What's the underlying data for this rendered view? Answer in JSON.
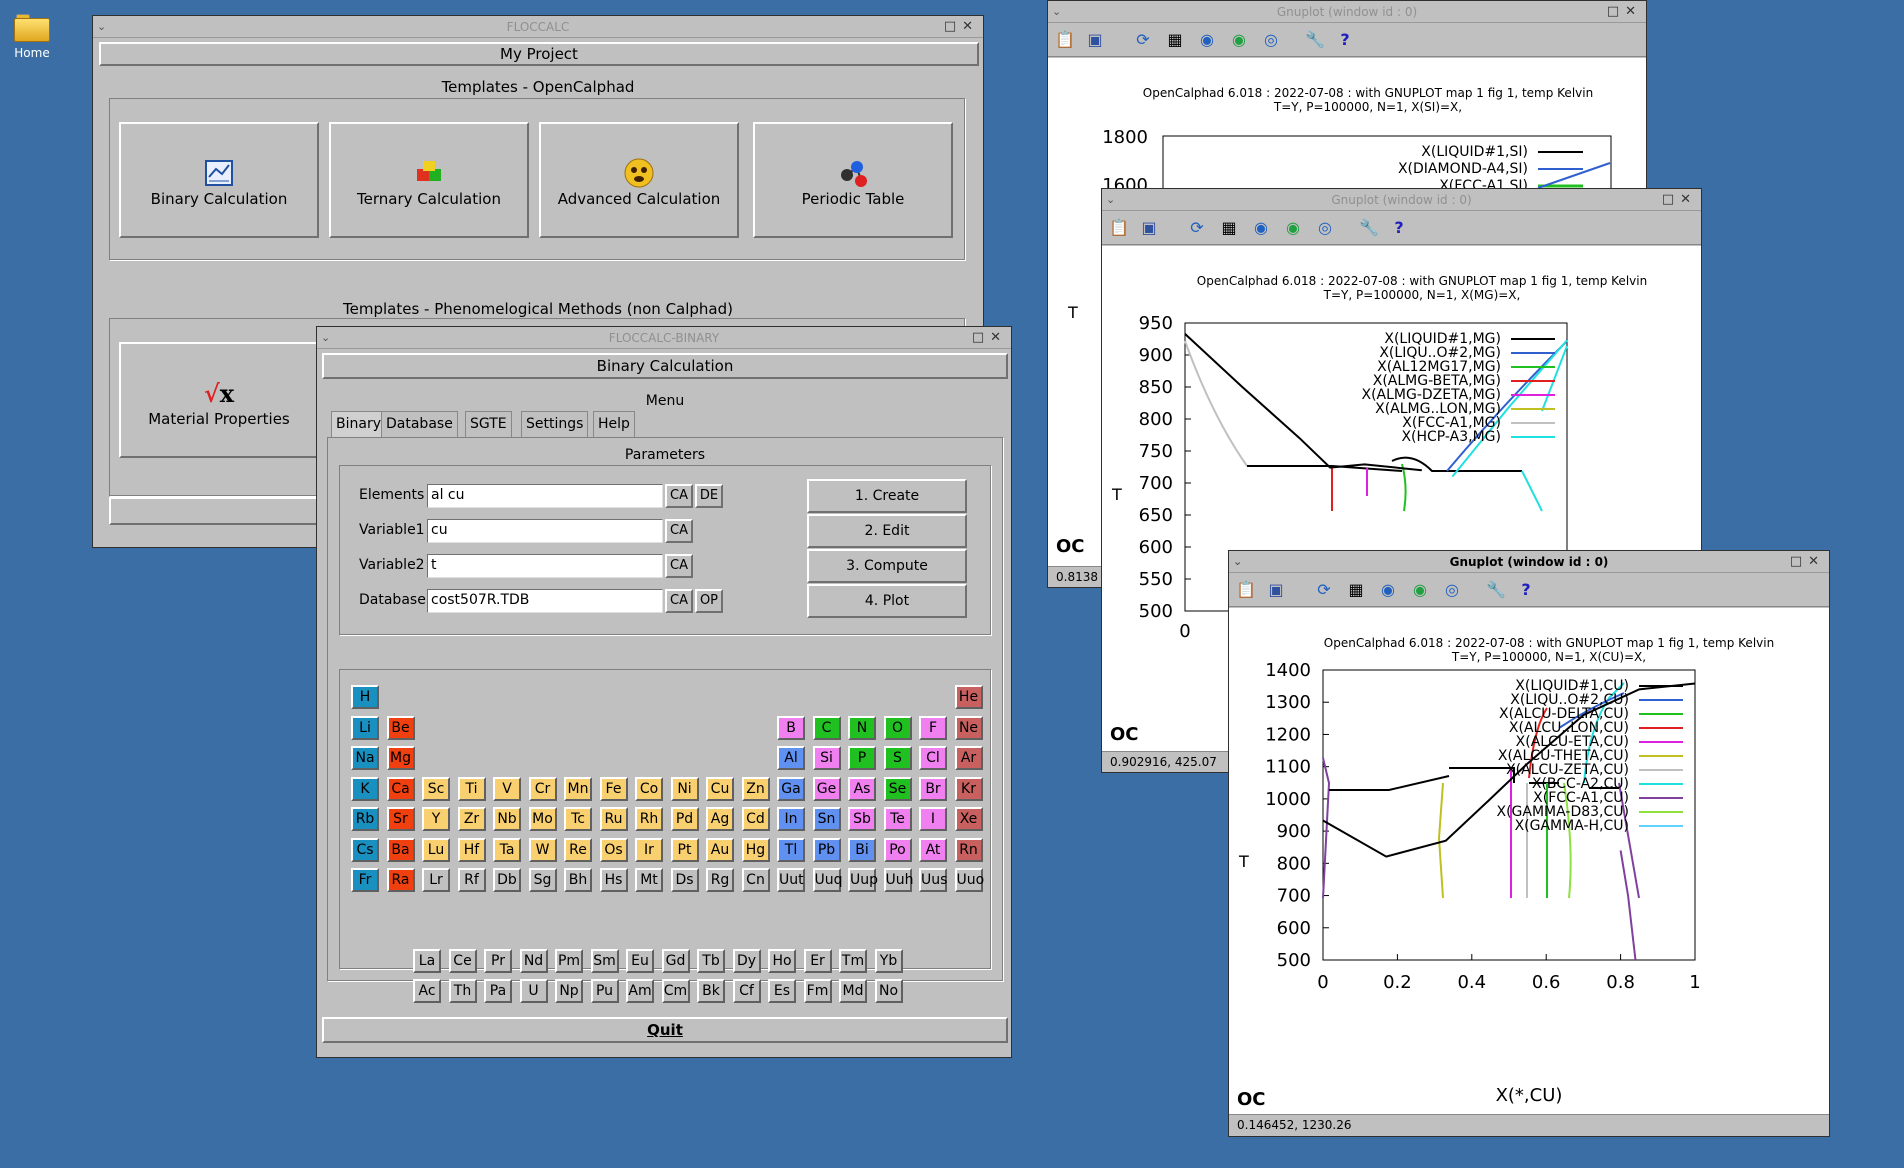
{
  "desktop": {
    "home_label": "Home"
  },
  "floccalc": {
    "title": "FLOCCALC",
    "project_button": "My Project",
    "templates_opencalphad": "Templates - OpenCalphad",
    "btn_binary": "Binary Calculation",
    "btn_ternary": "Ternary Calculation",
    "btn_advanced": "Advanced Calculation",
    "btn_periodic": "Periodic Table",
    "templates_pheno": "Templates - Phenomelogical Methods (non Calphad)",
    "btn_material": "Material Properties"
  },
  "binary": {
    "title": "FLOCCALC-BINARY",
    "header": "Binary Calculation",
    "menu_label": "Menu",
    "tabs": [
      "Binary",
      "Database",
      "SGTE",
      "Settings",
      "Help"
    ],
    "params_label": "Parameters",
    "fields": {
      "elements_label": "Elements",
      "elements_value": "al cu",
      "var1_label": "Variable1",
      "var1_value": "cu",
      "var2_label": "Variable2",
      "var2_value": "t",
      "db_label": "Database",
      "db_value": "cost507R.TDB"
    },
    "small_btns": {
      "ca": "CA",
      "de": "DE",
      "op": "OP"
    },
    "actions": [
      "1. Create",
      "2. Edit",
      "3. Compute",
      "4. Plot"
    ],
    "quit": "Quit",
    "periodic_rows": [
      [
        "H",
        "",
        "",
        "",
        "",
        "",
        "",
        "",
        "",
        "",
        "",
        "",
        "",
        "",
        "",
        "",
        "",
        "He"
      ],
      [
        "Li",
        "Be",
        "",
        "",
        "",
        "",
        "",
        "",
        "",
        "",
        "",
        "",
        "B",
        "C",
        "N",
        "O",
        "F",
        "Ne"
      ],
      [
        "Na",
        "Mg",
        "",
        "",
        "",
        "",
        "",
        "",
        "",
        "",
        "",
        "",
        "Al",
        "Si",
        "P",
        "S",
        "Cl",
        "Ar"
      ],
      [
        "K",
        "Ca",
        "Sc",
        "Ti",
        "V",
        "Cr",
        "Mn",
        "Fe",
        "Co",
        "Ni",
        "Cu",
        "Zn",
        "Ga",
        "Ge",
        "As",
        "Se",
        "Br",
        "Kr"
      ],
      [
        "Rb",
        "Sr",
        "Y",
        "Zr",
        "Nb",
        "Mo",
        "Tc",
        "Ru",
        "Rh",
        "Pd",
        "Ag",
        "Cd",
        "In",
        "Sn",
        "Sb",
        "Te",
        "I",
        "Xe"
      ],
      [
        "Cs",
        "Ba",
        "Lu",
        "Hf",
        "Ta",
        "W",
        "Re",
        "Os",
        "Ir",
        "Pt",
        "Au",
        "Hg",
        "Tl",
        "Pb",
        "Bi",
        "Po",
        "At",
        "Rn"
      ],
      [
        "Fr",
        "Ra",
        "Lr",
        "Rf",
        "Db",
        "Sg",
        "Bh",
        "Hs",
        "Mt",
        "Ds",
        "Rg",
        "Cn",
        "Uut",
        "Uuq",
        "Uup",
        "Uuh",
        "Uus",
        "Uuo"
      ]
    ],
    "lanthanides": [
      "La",
      "Ce",
      "Pr",
      "Nd",
      "Pm",
      "Sm",
      "Eu",
      "Gd",
      "Tb",
      "Dy",
      "Ho",
      "Er",
      "Tm",
      "Yb"
    ],
    "actinides": [
      "Ac",
      "Th",
      "Pa",
      "U",
      "Np",
      "Pu",
      "Am",
      "Cm",
      "Bk",
      "Cf",
      "Es",
      "Fm",
      "Md",
      "No"
    ],
    "colors": {
      "alkali": "#1a90c0",
      "alkaline": "#f04010",
      "transition": "#f8d070",
      "post": "#6090f0",
      "metalloid": "#f080f0",
      "nonmetal": "#20c020",
      "noble": "#c86060",
      "heavy": "#c0c0c0",
      "lanth": "#c0c0c0"
    }
  },
  "gp1": {
    "title": "Gnuplot (window id : 0)",
    "header1": "OpenCalphad    6.018 :   2022-07-08 : with GNUPLOT map 1 fig 1, temp Kelvin",
    "header2": "T=Y,  P=100000, N=1, X(SI)=X,",
    "y_ticks": [
      "1800",
      "1600"
    ],
    "legend": [
      "X(LIQUID#1,SI)",
      "X(DIAMOND-A4,SI)",
      "X(FCC-A1,SI)"
    ],
    "legend_colors": [
      "#000000",
      "#3060d0",
      "#20c020"
    ],
    "ylabel": "T",
    "status": "0.8138"
  },
  "gp2": {
    "title": "Gnuplot (window id : 0)",
    "header1": "OpenCalphad    6.018 :   2022-07-08 : with GNUPLOT map 1 fig 1, temp Kelvin",
    "header2": "T=Y,  P=100000, N=1, X(MG)=X,",
    "ylabel": "T",
    "legend": [
      "X(LIQUID#1,MG)",
      "X(LIQU..O#2,MG)",
      "X(AL12MG17,MG)",
      "X(ALMG-BETA,MG)",
      "X(ALMG-DZETA,MG)",
      "X(ALMG..LON,MG)",
      "X(FCC-A1,MG)",
      "X(HCP-A3,MG)"
    ],
    "legend_colors": [
      "#000000",
      "#3060d0",
      "#20c020",
      "#e02020",
      "#e020e0",
      "#c0c020",
      "#c0c0c0",
      "#20e0e0"
    ],
    "status": "0.902916,  425.07"
  },
  "gp3": {
    "title": "Gnuplot (window id : 0)",
    "header1": "OpenCalphad    6.018 :   2022-07-08 : with GNUPLOT map 1 fig 1, temp Kelvin",
    "header2": "T=Y,  P=100000, N=1, X(CU)=X,",
    "ylabel": "T",
    "xlabel": "X(*,CU)",
    "legend": [
      "X(LIQUID#1,CU)",
      "X(LIQU..O#2,CU)",
      "X(ALCU-DELTA,CU)",
      "X(ALCU..LON,CU)",
      "X(ALCU-ETA,CU)",
      "X(ALCU-THETA,CU)",
      "X(ALCU-ZETA,CU)",
      "X(BCC-A2,CU)",
      "X(FCC-A1,CU)",
      "X(GAMMA-D83,CU)",
      "X(GAMMA-H,CU)"
    ],
    "legend_colors": [
      "#000000",
      "#3060d0",
      "#20c020",
      "#e02020",
      "#e020e0",
      "#c0c020",
      "#c0c0c0",
      "#20e0e0",
      "#8040a0",
      "#90e040",
      "#60d0ff"
    ],
    "status": "0.146452,  1230.26"
  },
  "chart_data": [
    {
      "type": "line",
      "title": "OpenCalphad    6.018 :   2022-07-08 : with GNUPLOT map 1 fig 1, temp Kelvin",
      "subtitle": "T=Y,  P=100000, N=1, X(MG)=X,",
      "ylabel": "T",
      "y_ticks": [
        950,
        900,
        850,
        800,
        750,
        700,
        650,
        600,
        550,
        500
      ],
      "x_ticks_visible": [
        "0"
      ],
      "ylim": [
        500,
        950
      ],
      "xlim": [
        0,
        1
      ],
      "series": [
        {
          "name": "X(LIQUID#1,MG)",
          "x": [
            0,
            0.15,
            0.3,
            0.38,
            0.47,
            0.62
          ],
          "y": [
            933,
            850,
            770,
            724,
            729,
            720
          ]
        },
        {
          "name": "X(HCP-A3,MG)",
          "x": [
            0.7,
            0.85,
            1.0
          ],
          "y": [
            710,
            820,
            923
          ]
        }
      ]
    },
    {
      "type": "line",
      "title": "OpenCalphad    6.018 :   2022-07-08 : with GNUPLOT map 1 fig 1, temp Kelvin",
      "subtitle": "T=Y,  P=100000, N=1, X(CU)=X,",
      "xlabel": "X(*,CU)",
      "ylabel": "T",
      "x_ticks": [
        0,
        0.2,
        0.4,
        0.6,
        0.8,
        1
      ],
      "y_ticks": [
        1400,
        1300,
        1200,
        1100,
        1000,
        900,
        800,
        700,
        600,
        500
      ],
      "xlim": [
        0,
        1
      ],
      "ylim": [
        500,
        1400
      ],
      "series": [
        {
          "name": "X(LIQUID#1,CU)",
          "x": [
            0,
            0.17,
            0.33,
            0.45,
            0.55,
            0.7,
            0.85,
            1.0
          ],
          "y": [
            933,
            821,
            870,
            1000,
            1110,
            1260,
            1340,
            1358
          ]
        },
        {
          "name": "X(FCC-A1,CU)",
          "x": [
            0.8,
            0.82,
            0.84
          ],
          "y": [
            840,
            700,
            500
          ]
        }
      ]
    }
  ]
}
